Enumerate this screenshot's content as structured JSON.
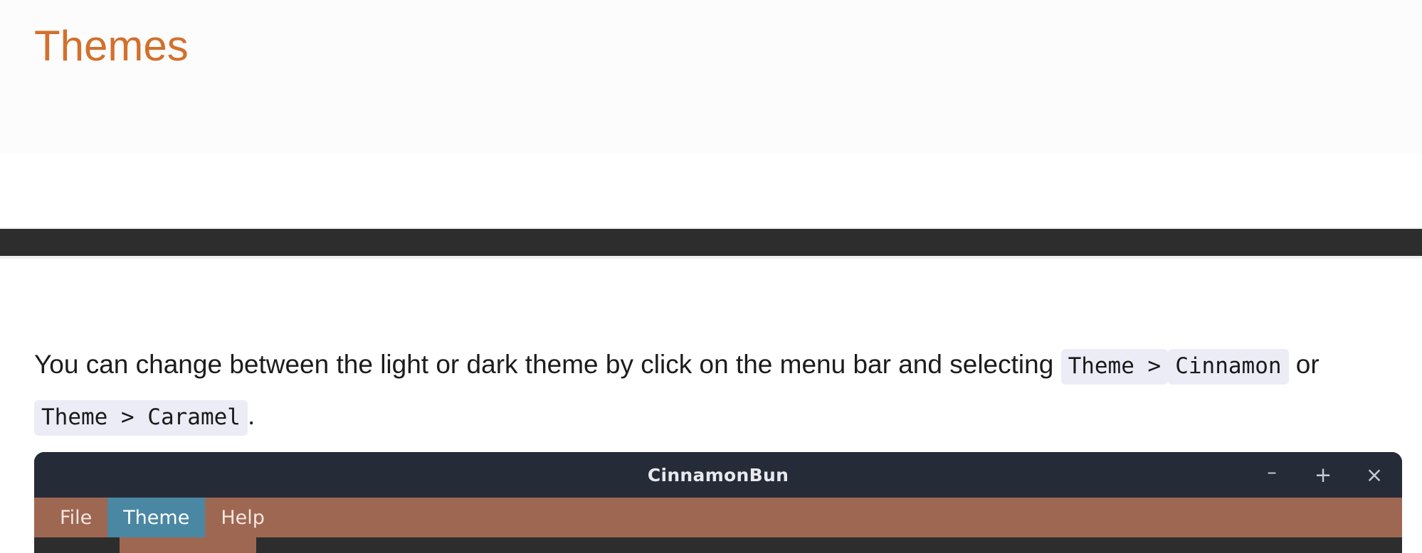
{
  "page": {
    "title": "Themes",
    "accent_color": "#d2702c",
    "header_bg": "#fcfcfc",
    "nav_strip_color": "#2d2d2d"
  },
  "paragraph": {
    "part1": "You can change between the light or dark theme by click on the menu bar and selecting ",
    "code1": "Theme >",
    "part2": "",
    "code2": "Cinnamon",
    "part3": " or ",
    "code3": "Theme > Caramel",
    "part4": ".",
    "code_bg": "#ececf7"
  },
  "app_window": {
    "title": "CinnamonBun",
    "titlebar_color": "#262b38",
    "menubar_color": "#9e6752",
    "highlight_color": "#4a87a2",
    "controls": {
      "minimize": "–",
      "maximize": "+",
      "close": "×"
    },
    "menu_items": [
      {
        "label": "File",
        "active": false
      },
      {
        "label": "Theme",
        "active": true
      },
      {
        "label": "Help",
        "active": false
      }
    ]
  }
}
